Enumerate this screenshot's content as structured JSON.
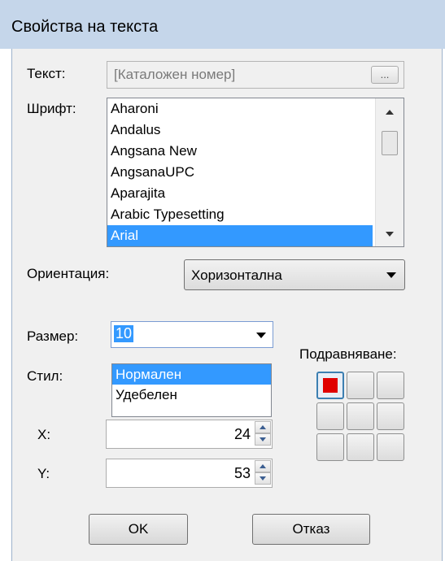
{
  "window": {
    "title": "Свойства на текста"
  },
  "form": {
    "text_label": "Текст:",
    "text_value": "[Каталожен номер]",
    "browse_label": "...",
    "font_label": "Шрифт:",
    "fonts": [
      "Aharoni",
      "Andalus",
      "Angsana New",
      "AngsanaUPC",
      "Aparajita",
      "Arabic Typesetting",
      "Arial"
    ],
    "selected_font": "Arial",
    "orientation_label": "Ориентация:",
    "orientation_value": "Хоризонтална",
    "size_label": "Размер:",
    "size_value": "10",
    "style_label": "Стил:",
    "styles": [
      "Нормален",
      "Удебелен"
    ],
    "selected_style": "Нормален",
    "x_label": "X:",
    "x_value": "24",
    "y_label": "Y:",
    "y_value": "53",
    "alignment_label": "Подравняване:",
    "alignment_selected": "top-left"
  },
  "buttons": {
    "ok": "OK",
    "cancel": "Отказ"
  },
  "colors": {
    "selection": "#3399ff",
    "alignment_marker": "#e00000",
    "title_bar": "#c5d6ea"
  }
}
